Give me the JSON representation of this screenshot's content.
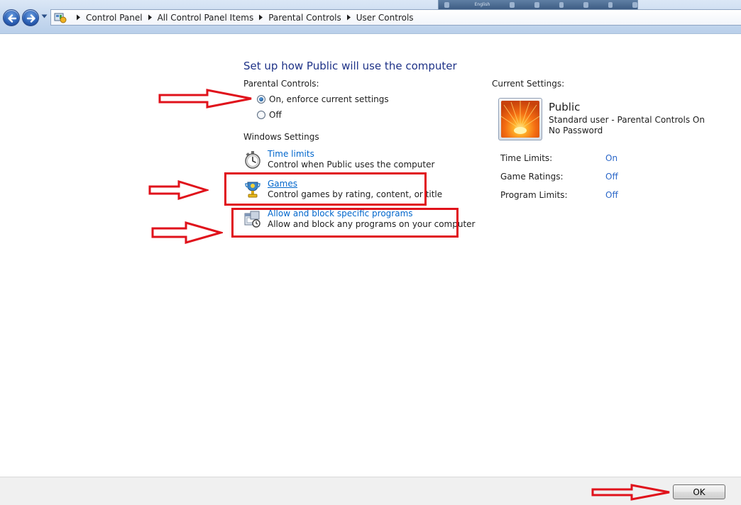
{
  "breadcrumb": {
    "items": [
      "Control Panel",
      "All Control Panel Items",
      "Parental Controls",
      "User Controls"
    ]
  },
  "tray": {
    "language": "English"
  },
  "main": {
    "title": "Set up how Public will use the computer",
    "parental_controls": {
      "label": "Parental Controls:",
      "options": [
        "On, enforce current settings",
        "Off"
      ],
      "selected": 0
    },
    "windows_settings": {
      "label": "Windows Settings",
      "items": [
        {
          "title": "Time limits",
          "description": "Control when Public uses the computer",
          "icon": "stopwatch-icon"
        },
        {
          "title": "Games",
          "description": "Control games by rating, content, or title",
          "icon": "games-trophy-icon"
        },
        {
          "title": "Allow and block specific programs",
          "description": "Allow and block any programs on your computer",
          "icon": "programs-icon"
        }
      ]
    }
  },
  "current_settings": {
    "label": "Current Settings:",
    "user": {
      "name": "Public",
      "details": [
        "Standard user - Parental Controls On",
        "No Password"
      ]
    },
    "rows": [
      {
        "label": "Time Limits:",
        "value": "On"
      },
      {
        "label": "Game Ratings:",
        "value": "Off"
      },
      {
        "label": "Program Limits:",
        "value": "Off"
      }
    ]
  },
  "footer": {
    "ok_label": "OK"
  },
  "colors": {
    "link": "#0066cc",
    "status_value": "#2a66c8",
    "title": "#1e3287",
    "annotation_red": "#e0121b"
  }
}
